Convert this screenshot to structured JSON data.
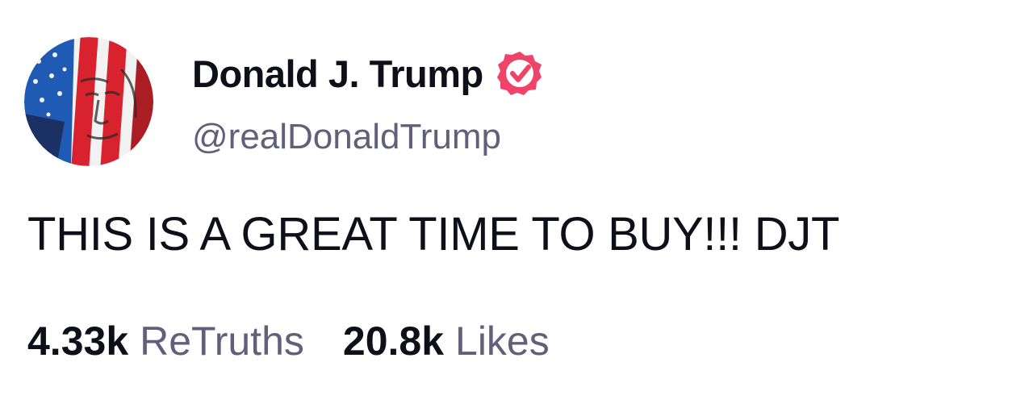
{
  "author": {
    "display_name": "Donald J. Trump",
    "handle": "@realDonaldTrump",
    "verified": true,
    "avatar_icon": "flag-portrait-avatar",
    "verified_icon": "verified-badge-icon"
  },
  "post": {
    "text": "THIS IS A GREAT TIME TO BUY!!! DJT"
  },
  "stats": {
    "retruths_count": "4.33k",
    "retruths_label": "ReTruths",
    "likes_count": "20.8k",
    "likes_label": "Likes"
  },
  "colors": {
    "text_primary": "#0f0f1a",
    "text_secondary": "#60607a",
    "verified_badge": "#f0436a",
    "flag_red": "#d8232f",
    "flag_blue": "#1f5bb5",
    "flag_white": "#f2f2f2"
  }
}
